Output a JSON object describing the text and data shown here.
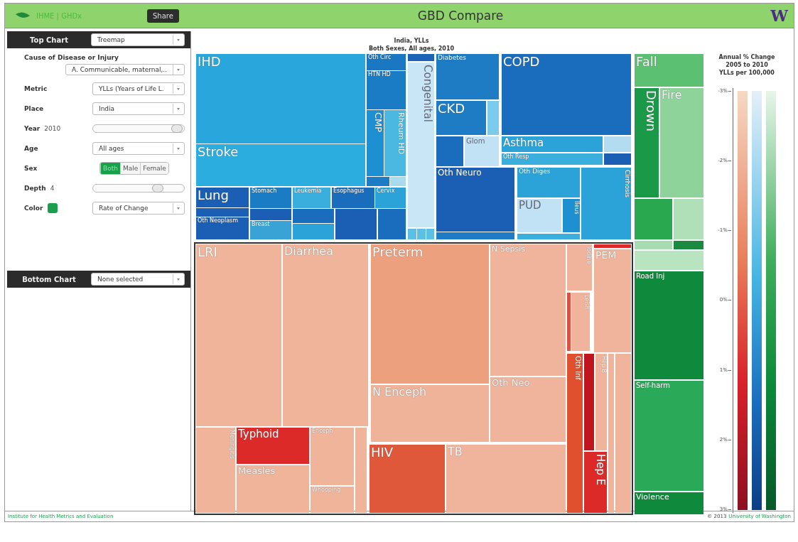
{
  "header": {
    "brand": "IHME | GHDx",
    "share_button": "Share",
    "title": "GBD Compare",
    "logo": "W"
  },
  "top_chart": {
    "label": "Top Chart",
    "value": "Treemap"
  },
  "controls": [
    {
      "kind": "stacked-select",
      "label": "Cause of Disease or Injury",
      "value": "A. Communicable, maternal,.."
    },
    {
      "kind": "select",
      "label": "Metric",
      "value": "YLLs (Years of Life L."
    },
    {
      "kind": "select",
      "label": "Place",
      "value": "India"
    },
    {
      "kind": "slider",
      "label": "Year",
      "reading": "2010",
      "level": 0.98
    },
    {
      "kind": "select",
      "label": "Age",
      "value": "All ages"
    },
    {
      "kind": "segmented",
      "label": "Sex",
      "options": [
        {
          "label": "Both",
          "selected": true
        },
        {
          "label": "Male",
          "selected": false
        },
        {
          "label": "Female",
          "selected": false
        }
      ]
    },
    {
      "kind": "slider",
      "label": "Depth",
      "reading": "4",
      "level": 0.74
    },
    {
      "kind": "color-select",
      "label": "Color",
      "color": "#1aa04a",
      "value": "Rate of Change"
    }
  ],
  "bottom_chart": {
    "label": "Bottom Chart",
    "value": "None selected"
  },
  "chart": {
    "title_lines": [
      "India, YLLs",
      "Both Sexes, All ages, 2010"
    ],
    "cells": [
      {
        "label": "IHD",
        "color": "#29a7dc",
        "kind": "horizontal"
      },
      {
        "label": "Stroke",
        "color": "#2bade0",
        "kind": "horizontal"
      },
      {
        "label": "Oth Circ",
        "color": "#1a78c2",
        "kind": "horizontal"
      },
      {
        "label": "HTN HD",
        "color": "#1a7cc4",
        "kind": "horizontal"
      },
      {
        "label": "CMP",
        "color": "#1e8fd0",
        "kind": "vertical"
      },
      {
        "label": "Rheum HD",
        "color": "#4ab8e0",
        "kind": "vertical"
      },
      {
        "color": "#1e7cc4"
      },
      {
        "color": "#a8daf0"
      },
      {
        "color": "#1c62b5"
      },
      {
        "label": "Congenital",
        "color": "#c8e6f5",
        "kind": "vertical"
      },
      {
        "color": "#5cc0e6"
      },
      {
        "color": "#5cc0e6"
      },
      {
        "color": "#5cc0e6"
      },
      {
        "label": "Lung",
        "color": "#1a5fb4",
        "kind": "horizontal"
      },
      {
        "color": "#1a5fb4"
      },
      {
        "label": "Oth Neoplasm",
        "color": "#1a5fb4",
        "kind": "horizontal"
      },
      {
        "label": "Stomach",
        "color": "#1a7cc4",
        "kind": "horizontal"
      },
      {
        "color": "#1a5fb4"
      },
      {
        "label": "Breast",
        "color": "#3aa3d6",
        "kind": "horizontal"
      },
      {
        "label": "Leukemia",
        "color": "#3aaedc",
        "kind": "horizontal"
      },
      {
        "label": "Esophagus",
        "color": "#1a6cbc",
        "kind": "horizontal"
      },
      {
        "label": "Cervix",
        "color": "#2ba3d8",
        "kind": "horizontal"
      },
      {
        "color": "#1a6cbc"
      },
      {
        "color": "#2ba3d8"
      },
      {
        "color": "#1a5fb4"
      },
      {
        "color": "#1a6cbc"
      },
      {
        "label": "Diabetes",
        "color": "#1e7cc4",
        "kind": "horizontal"
      },
      {
        "label": "CKD",
        "color": "#1e7cc4",
        "kind": "horizontal"
      },
      {
        "color": "#7ccbea"
      },
      {
        "color": "#1a6cbc"
      },
      {
        "label": "Glom",
        "color": "#c0e2f4",
        "kind": "horizontal"
      },
      {
        "label": "COPD",
        "color": "#1a6cbc",
        "kind": "horizontal"
      },
      {
        "label": "Asthma",
        "color": "#2ba3d8",
        "kind": "horizontal"
      },
      {
        "label": "Oth Resp",
        "color": "#3aaedc",
        "kind": "horizontal"
      },
      {
        "color": "#b4dcf0"
      },
      {
        "color": "#1a5fb4"
      },
      {
        "label": "Oth Neuro",
        "color": "#1a5fb4",
        "kind": "horizontal"
      },
      {
        "color": "#1e7cc4"
      },
      {
        "label": "Oth Diges",
        "color": "#2ba3d8",
        "kind": "horizontal"
      },
      {
        "label": "PUD",
        "color": "#c0e2f4",
        "kind": "horizontal"
      },
      {
        "label": "Ileus",
        "color": "#1e8fd0",
        "kind": "vertical"
      },
      {
        "color": "#3aaedc"
      },
      {
        "label": "Cirrhosis",
        "color": "#2ba3d8",
        "kind": "vertical"
      },
      {
        "label": "Fall",
        "color": "#5cc072",
        "kind": "horizontal"
      },
      {
        "label": "Drown",
        "color": "#1a9a48",
        "kind": "vertical"
      },
      {
        "label": "Fire",
        "color": "#8ed49a",
        "kind": "horizontal"
      },
      {
        "color": "#2aa850"
      },
      {
        "color": "#b0e0b8"
      },
      {
        "color": "#a8dcb0"
      },
      {
        "color": "#1a8a40"
      },
      {
        "color": "#b8e4c0"
      },
      {
        "label": "Road Inj",
        "color": "#0f8a3c",
        "kind": "horizontal"
      },
      {
        "label": "Self-harm",
        "color": "#2aaa58",
        "kind": "horizontal"
      },
      {
        "label": "Violence",
        "color": "#0f8a3c",
        "kind": "horizontal"
      },
      {
        "label": "LRI",
        "color": "#efb49a",
        "kind": "horizontal"
      },
      {
        "label": "Diarrhea",
        "color": "#efb49a",
        "kind": "horizontal"
      },
      {
        "label": "Preterm",
        "color": "#eca07e",
        "kind": "horizontal"
      },
      {
        "label": "N Sepsis",
        "color": "#f0b49c",
        "kind": "horizontal"
      },
      {
        "label": "N Enceph",
        "color": "#efb39a",
        "kind": "horizontal"
      },
      {
        "label": "Oth Neo",
        "color": "#f0b49c",
        "kind": "horizontal"
      },
      {
        "label": "Meningitis",
        "color": "#efb49a",
        "kind": "vertical"
      },
      {
        "label": "Typhoid",
        "color": "#dc2a28",
        "kind": "horizontal"
      },
      {
        "label": "Measles",
        "color": "#efb49a",
        "kind": "horizontal"
      },
      {
        "label": "Enceph",
        "color": "#efb49a",
        "kind": "horizontal"
      },
      {
        "label": "Whooping",
        "color": "#efb49a",
        "kind": "horizontal"
      },
      {
        "color": "#efb49a"
      },
      {
        "label": "HIV",
        "color": "#e0583a",
        "kind": "horizontal"
      },
      {
        "label": "TB",
        "color": "#f0b49c",
        "kind": "horizontal"
      },
      {
        "label": "Iodine",
        "color": "#f0b49c",
        "kind": "vertical"
      },
      {
        "color": "#e05040"
      },
      {
        "label": "Leish",
        "color": "#f0b49c",
        "kind": "vertical"
      },
      {
        "label": "PEM",
        "color": "#f0b49c",
        "kind": "horizontal"
      },
      {
        "color": "#dc2a28"
      },
      {
        "label": "Oth Inf",
        "color": "#e0502e",
        "kind": "vertical"
      },
      {
        "color": "#c0141e"
      },
      {
        "label": "Hep E",
        "color": "#dc2a28",
        "kind": "vertical"
      },
      {
        "label": "Hep B",
        "color": "#f0b49c",
        "kind": "vertical"
      },
      {
        "color": "#f0b49c"
      },
      {
        "color": "#f0b49c"
      }
    ]
  },
  "legend": {
    "title_lines": [
      "Annual % Change",
      "2005 to 2010",
      "YLLs per 100,000"
    ],
    "ticks": [
      "-3%",
      "-2%",
      "-1%",
      "0%",
      "1%",
      "2%",
      "3%"
    ]
  },
  "footer": {
    "left": "Institute for Health Metrics and Evaluation",
    "copyright": "© 2013",
    "link": "University of Washington"
  }
}
